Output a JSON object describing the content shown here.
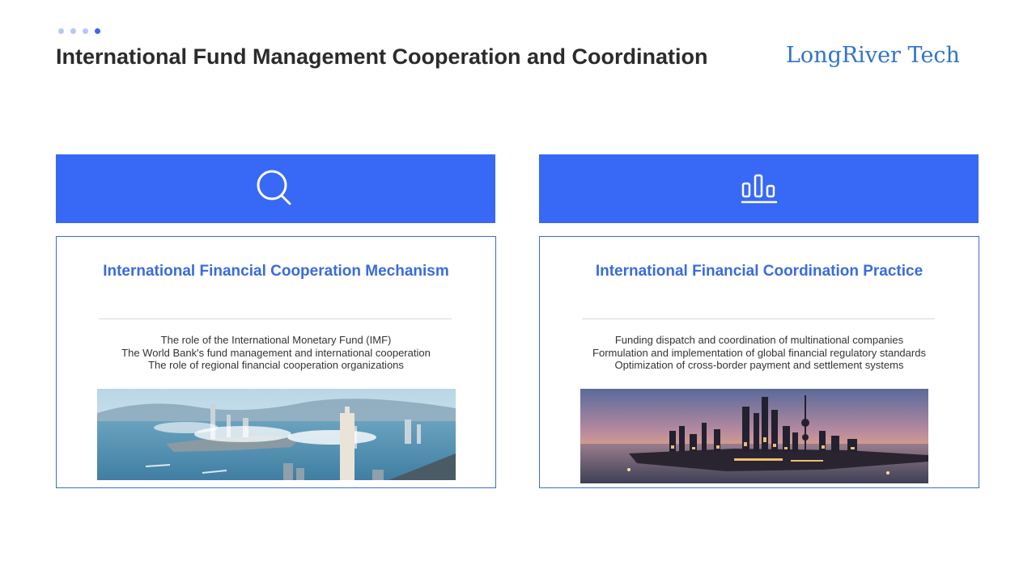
{
  "header": {
    "title": "International Fund Management Cooperation and Coordination",
    "brand": "LongRiver Tech"
  },
  "pagination_dots": {
    "count": 4,
    "active_index": 3
  },
  "colors": {
    "accent": "#3868f6",
    "title_blue": "#3a6bdc",
    "brand_blue": "#2f74c9"
  },
  "cards": [
    {
      "icon": "search-icon",
      "title": "International Financial Cooperation Mechanism",
      "lines": [
        "The role of the International Monetary Fund (IMF)",
        "The World Bank's fund management and international cooperation",
        "The role of regional financial cooperation organizations"
      ],
      "image": "harbor-city-skyline-photo"
    },
    {
      "icon": "bar-chart-icon",
      "title": "International Financial Coordination Practice",
      "lines": [
        "Funding dispatch and coordination of multinational companies",
        "Formulation and implementation of global financial regulatory standards",
        "Optimization of cross-border payment and settlement systems"
      ],
      "image": "river-city-sunset-skyline-photo"
    }
  ]
}
